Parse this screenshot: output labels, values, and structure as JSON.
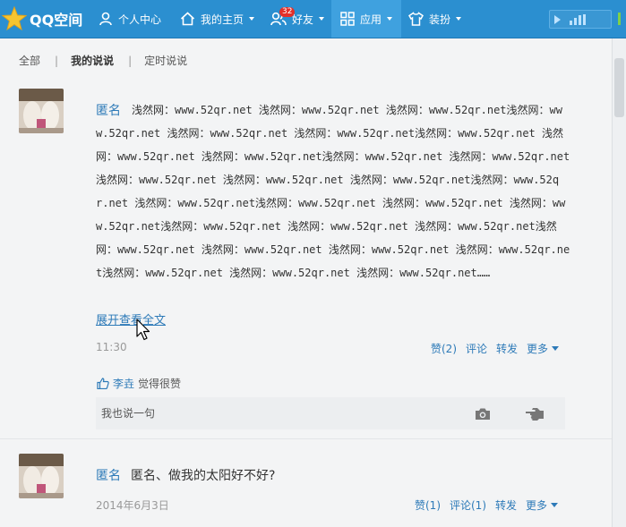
{
  "topbar": {
    "brand": "QQ空间",
    "nav": [
      {
        "label": "个人中心"
      },
      {
        "label": "我的主页"
      },
      {
        "label": "好友",
        "badge": "32"
      },
      {
        "label": "应用"
      },
      {
        "label": "装扮"
      }
    ]
  },
  "filters": {
    "items": [
      "全部",
      "我的说说",
      "定时说说"
    ],
    "current": "我的说说"
  },
  "post1": {
    "author": "匿名",
    "text": "浅然网：www.52qr.net 浅然网：www.52qr.net 浅然网：www.52qr.net浅然网：www.52qr.net 浅然网：www.52qr.net 浅然网：www.52qr.net浅然网：www.52qr.net 浅然网：www.52qr.net 浅然网：www.52qr.net浅然网：www.52qr.net 浅然网：www.52qr.net浅然网：www.52qr.net 浅然网：www.52qr.net 浅然网：www.52qr.net浅然网：www.52qr.net 浅然网：www.52qr.net浅然网：www.52qr.net 浅然网：www.52qr.net 浅然网：www.52qr.net浅然网：www.52qr.net 浅然网：www.52qr.net 浅然网：www.52qr.net浅然网：www.52qr.net 浅然网：www.52qr.net 浅然网：www.52qr.net 浅然网：www.52qr.net浅然网：www.52qr.net 浅然网：www.52qr.net 浅然网：www.52qr.net……",
    "expand": "展开查看全文",
    "time": "11:30",
    "like": "赞(2)",
    "comment": "评论",
    "share": "转发",
    "more": "更多",
    "liker": "李垚",
    "liked_text": "觉得很赞",
    "comment_placeholder": "我也说一句"
  },
  "post2": {
    "author": "匿名",
    "text": "匿名、做我的太阳好不好?",
    "time": "2014年6月3日",
    "like": "赞(1)",
    "comment": "评论(1)",
    "share": "转发",
    "more": "更多"
  },
  "colors": {
    "topbar": "#2b8fd0",
    "link": "#2d7ab8",
    "badge": "#e2302a",
    "background": "#f3f4f5"
  }
}
